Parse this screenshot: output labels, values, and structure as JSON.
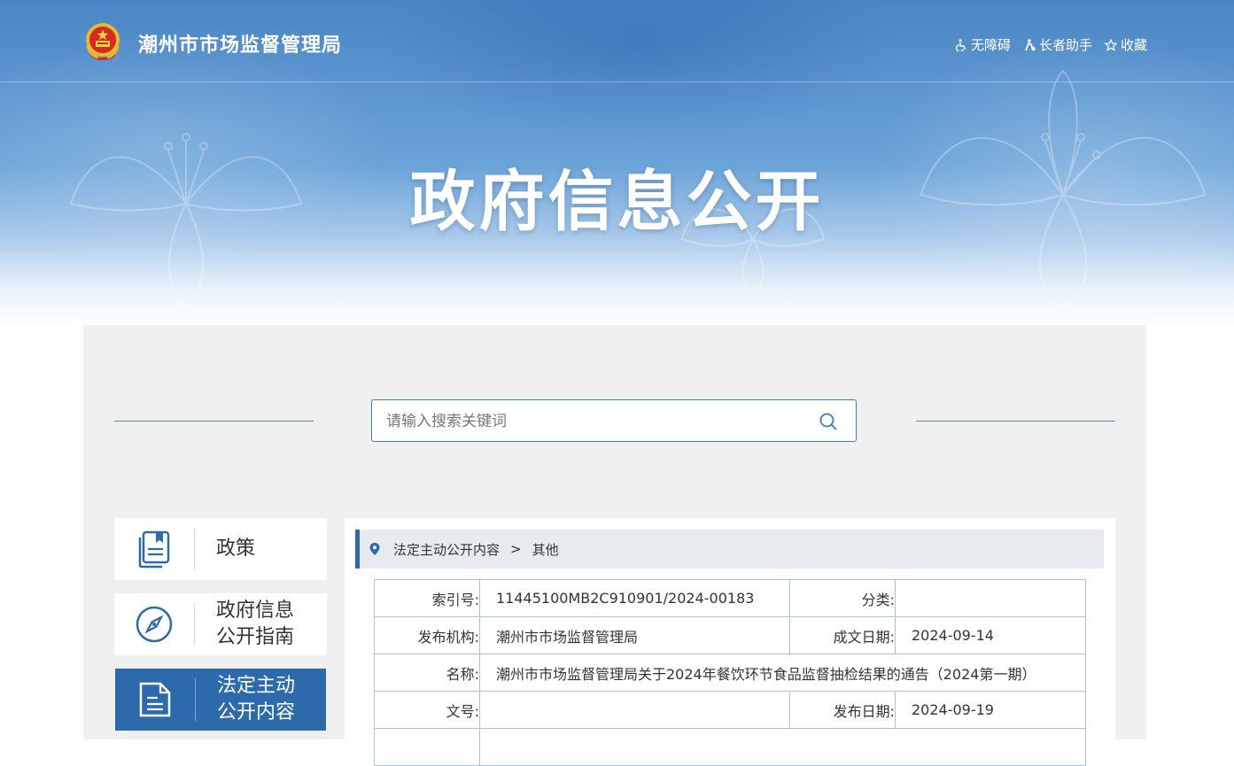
{
  "header": {
    "site_title": "潮州市市场监督管理局",
    "tools": [
      {
        "label": "无障碍",
        "icon": "accessibility-icon"
      },
      {
        "label": "长者助手",
        "icon": "elder-assist-icon"
      },
      {
        "label": "收藏",
        "icon": "star-icon"
      }
    ]
  },
  "hero": {
    "title": "政府信息公开"
  },
  "search": {
    "placeholder": "请输入搜索关键词"
  },
  "sidebar": {
    "items": [
      {
        "label": "政策",
        "icon": "document-icon",
        "active": false
      },
      {
        "label": "政府信息公开指南",
        "line1": "政府信息",
        "line2": "公开指南",
        "icon": "compass-icon",
        "active": false
      },
      {
        "label": "法定主动公开内容",
        "line1": "法定主动",
        "line2": "公开内容",
        "icon": "file-text-icon",
        "active": true
      }
    ]
  },
  "breadcrumb": {
    "items": [
      "法定主动公开内容",
      "其他"
    ],
    "separator": ">"
  },
  "meta": {
    "index_label": "索引号:",
    "index_value": "11445100MB2C910901/2024-00183",
    "category_label": "分类:",
    "category_value": "",
    "publisher_label": "发布机构:",
    "publisher_value": "潮州市市场监督管理局",
    "created_label": "成文日期:",
    "created_value": "2024-09-14",
    "name_label": "名称:",
    "name_value": "潮州市市场监督管理局关于2024年餐饮环节食品监督抽检结果的通告（2024第一期）",
    "docno_label": "文号:",
    "docno_value": "",
    "published_label": "发布日期:",
    "published_value": "2024-09-19"
  },
  "colors": {
    "primary": "#2d6aab",
    "panel_bg": "#f0f0f0",
    "table_border": "#a9c4dd"
  }
}
